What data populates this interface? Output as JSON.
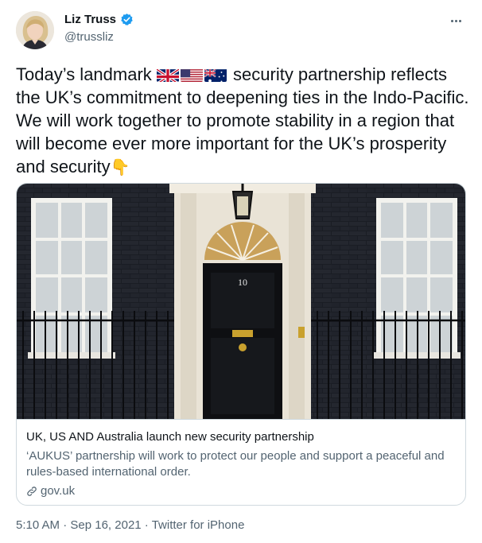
{
  "author": {
    "display_name": "Liz Truss",
    "handle": "@trussliz",
    "verified_icon": "verified-badge-icon",
    "avatar": "profile-photo"
  },
  "tweet": {
    "text_part1": "Today’s landmark ",
    "flags": [
      "uk-flag-icon",
      "us-flag-icon",
      "australia-flag-icon"
    ],
    "text_part2": " security partnership reflects the UK’s commitment to deepening ties in the Indo-Pacific. We will work together to promote stability in a region that will become ever more important for the UK’s prosperity and security",
    "trailing_emoji": "👇"
  },
  "card": {
    "image": "number-10-downing-street-door",
    "door_number": "10",
    "title": "UK, US AND Australia launch new security partnership",
    "description": "‘AUKUS’ partnership will work to protect our people and support a peaceful and rules-based international order.",
    "domain": "gov.uk"
  },
  "meta": {
    "time": "5:10 AM",
    "separator1": " · ",
    "date": "Sep 16, 2021",
    "separator2": " · ",
    "source": "Twitter for iPhone"
  },
  "colors": {
    "text_primary": "#0f1419",
    "text_secondary": "#536471",
    "verified_blue": "#1d9bf0",
    "border": "#cfd9de"
  }
}
